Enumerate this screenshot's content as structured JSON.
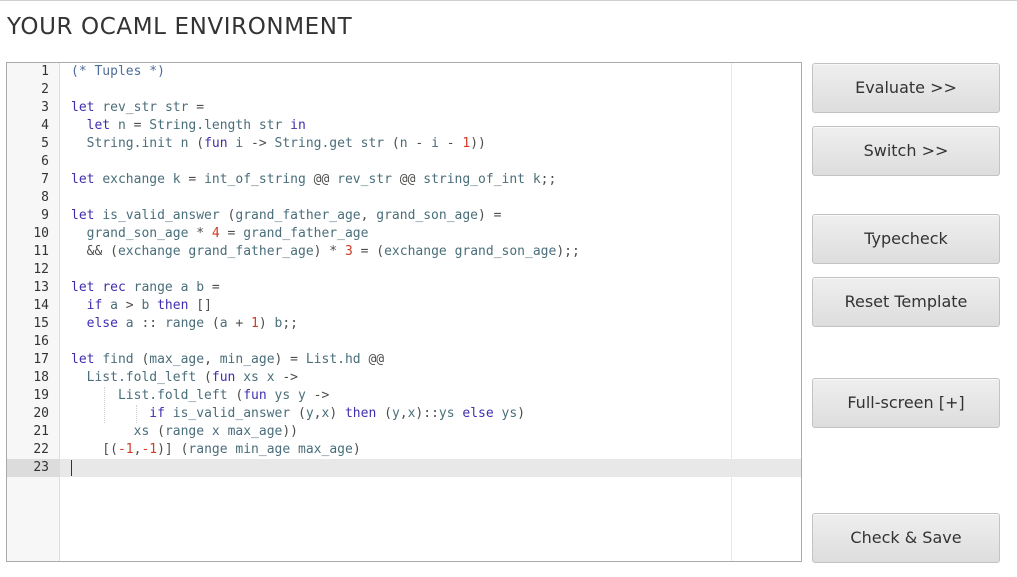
{
  "page": {
    "title": "YOUR OCAML ENVIRONMENT"
  },
  "editor": {
    "active_line": 23,
    "lines": [
      {
        "n": "1",
        "tokens": [
          {
            "c": "comment",
            "t": "(* Tuples *)"
          }
        ]
      },
      {
        "n": "2",
        "tokens": []
      },
      {
        "n": "3",
        "tokens": [
          {
            "c": "kw",
            "t": "let"
          },
          {
            "c": "op",
            "t": " "
          },
          {
            "c": "id",
            "t": "rev_str"
          },
          {
            "c": "op",
            "t": " "
          },
          {
            "c": "id",
            "t": "str"
          },
          {
            "c": "op",
            "t": " ="
          }
        ]
      },
      {
        "n": "4",
        "tokens": [
          {
            "c": "op",
            "t": "  "
          },
          {
            "c": "kw",
            "t": "let"
          },
          {
            "c": "op",
            "t": " "
          },
          {
            "c": "id",
            "t": "n"
          },
          {
            "c": "op",
            "t": " = "
          },
          {
            "c": "id",
            "t": "String.length"
          },
          {
            "c": "op",
            "t": " "
          },
          {
            "c": "id",
            "t": "str"
          },
          {
            "c": "op",
            "t": " "
          },
          {
            "c": "kw",
            "t": "in"
          }
        ]
      },
      {
        "n": "5",
        "tokens": [
          {
            "c": "op",
            "t": "  "
          },
          {
            "c": "id",
            "t": "String.init"
          },
          {
            "c": "op",
            "t": " "
          },
          {
            "c": "id",
            "t": "n"
          },
          {
            "c": "op",
            "t": " ("
          },
          {
            "c": "kw",
            "t": "fun"
          },
          {
            "c": "op",
            "t": " "
          },
          {
            "c": "id",
            "t": "i"
          },
          {
            "c": "op",
            "t": " -> "
          },
          {
            "c": "id",
            "t": "String.get"
          },
          {
            "c": "op",
            "t": " "
          },
          {
            "c": "id",
            "t": "str"
          },
          {
            "c": "op",
            "t": " ("
          },
          {
            "c": "id",
            "t": "n"
          },
          {
            "c": "op",
            "t": " - "
          },
          {
            "c": "id",
            "t": "i"
          },
          {
            "c": "op",
            "t": " - "
          },
          {
            "c": "num",
            "t": "1"
          },
          {
            "c": "op",
            "t": "))"
          }
        ]
      },
      {
        "n": "6",
        "tokens": []
      },
      {
        "n": "7",
        "tokens": [
          {
            "c": "kw",
            "t": "let"
          },
          {
            "c": "op",
            "t": " "
          },
          {
            "c": "id",
            "t": "exchange"
          },
          {
            "c": "op",
            "t": " "
          },
          {
            "c": "id",
            "t": "k"
          },
          {
            "c": "op",
            "t": " = "
          },
          {
            "c": "id",
            "t": "int_of_string"
          },
          {
            "c": "op",
            "t": " @@ "
          },
          {
            "c": "id",
            "t": "rev_str"
          },
          {
            "c": "op",
            "t": " @@ "
          },
          {
            "c": "id",
            "t": "string_of_int"
          },
          {
            "c": "op",
            "t": " "
          },
          {
            "c": "id",
            "t": "k"
          },
          {
            "c": "op",
            "t": ";;"
          }
        ]
      },
      {
        "n": "8",
        "tokens": []
      },
      {
        "n": "9",
        "tokens": [
          {
            "c": "kw",
            "t": "let"
          },
          {
            "c": "op",
            "t": " "
          },
          {
            "c": "id",
            "t": "is_valid_answer"
          },
          {
            "c": "op",
            "t": " ("
          },
          {
            "c": "id",
            "t": "grand_father_age"
          },
          {
            "c": "op",
            "t": ", "
          },
          {
            "c": "id",
            "t": "grand_son_age"
          },
          {
            "c": "op",
            "t": ") ="
          }
        ]
      },
      {
        "n": "10",
        "tokens": [
          {
            "c": "op",
            "t": "  "
          },
          {
            "c": "id",
            "t": "grand_son_age"
          },
          {
            "c": "op",
            "t": " * "
          },
          {
            "c": "num",
            "t": "4"
          },
          {
            "c": "op",
            "t": " = "
          },
          {
            "c": "id",
            "t": "grand_father_age"
          }
        ]
      },
      {
        "n": "11",
        "tokens": [
          {
            "c": "op",
            "t": "  && ("
          },
          {
            "c": "id",
            "t": "exchange"
          },
          {
            "c": "op",
            "t": " "
          },
          {
            "c": "id",
            "t": "grand_father_age"
          },
          {
            "c": "op",
            "t": ") * "
          },
          {
            "c": "num",
            "t": "3"
          },
          {
            "c": "op",
            "t": " = ("
          },
          {
            "c": "id",
            "t": "exchange"
          },
          {
            "c": "op",
            "t": " "
          },
          {
            "c": "id",
            "t": "grand_son_age"
          },
          {
            "c": "op",
            "t": ");;"
          }
        ]
      },
      {
        "n": "12",
        "tokens": []
      },
      {
        "n": "13",
        "tokens": [
          {
            "c": "kw",
            "t": "let"
          },
          {
            "c": "op",
            "t": " "
          },
          {
            "c": "kw",
            "t": "rec"
          },
          {
            "c": "op",
            "t": " "
          },
          {
            "c": "id",
            "t": "range"
          },
          {
            "c": "op",
            "t": " "
          },
          {
            "c": "id",
            "t": "a"
          },
          {
            "c": "op",
            "t": " "
          },
          {
            "c": "id",
            "t": "b"
          },
          {
            "c": "op",
            "t": " ="
          }
        ]
      },
      {
        "n": "14",
        "tokens": [
          {
            "c": "op",
            "t": "  "
          },
          {
            "c": "kw",
            "t": "if"
          },
          {
            "c": "op",
            "t": " "
          },
          {
            "c": "id",
            "t": "a"
          },
          {
            "c": "op",
            "t": " > "
          },
          {
            "c": "id",
            "t": "b"
          },
          {
            "c": "op",
            "t": " "
          },
          {
            "c": "kw",
            "t": "then"
          },
          {
            "c": "op",
            "t": " []"
          }
        ]
      },
      {
        "n": "15",
        "tokens": [
          {
            "c": "op",
            "t": "  "
          },
          {
            "c": "kw",
            "t": "else"
          },
          {
            "c": "op",
            "t": " "
          },
          {
            "c": "id",
            "t": "a"
          },
          {
            "c": "op",
            "t": " :: "
          },
          {
            "c": "id",
            "t": "range"
          },
          {
            "c": "op",
            "t": " ("
          },
          {
            "c": "id",
            "t": "a"
          },
          {
            "c": "op",
            "t": " + "
          },
          {
            "c": "num",
            "t": "1"
          },
          {
            "c": "op",
            "t": ") "
          },
          {
            "c": "id",
            "t": "b"
          },
          {
            "c": "op",
            "t": ";;"
          }
        ]
      },
      {
        "n": "16",
        "tokens": []
      },
      {
        "n": "17",
        "tokens": [
          {
            "c": "kw",
            "t": "let"
          },
          {
            "c": "op",
            "t": " "
          },
          {
            "c": "id",
            "t": "find"
          },
          {
            "c": "op",
            "t": " ("
          },
          {
            "c": "id",
            "t": "max_age"
          },
          {
            "c": "op",
            "t": ", "
          },
          {
            "c": "id",
            "t": "min_age"
          },
          {
            "c": "op",
            "t": ") = "
          },
          {
            "c": "id",
            "t": "List.hd"
          },
          {
            "c": "op",
            "t": " @@"
          }
        ]
      },
      {
        "n": "18",
        "tokens": [
          {
            "c": "op",
            "t": "  "
          },
          {
            "c": "id",
            "t": "List.fold_left"
          },
          {
            "c": "op",
            "t": " ("
          },
          {
            "c": "kw",
            "t": "fun"
          },
          {
            "c": "op",
            "t": " "
          },
          {
            "c": "id",
            "t": "xs"
          },
          {
            "c": "op",
            "t": " "
          },
          {
            "c": "id",
            "t": "x"
          },
          {
            "c": "op",
            "t": " ->"
          }
        ]
      },
      {
        "n": "19",
        "tokens": [
          {
            "c": "op",
            "t": "      "
          },
          {
            "c": "id",
            "t": "List.fold_left"
          },
          {
            "c": "op",
            "t": " ("
          },
          {
            "c": "kw",
            "t": "fun"
          },
          {
            "c": "op",
            "t": " "
          },
          {
            "c": "id",
            "t": "ys"
          },
          {
            "c": "op",
            "t": " "
          },
          {
            "c": "id",
            "t": "y"
          },
          {
            "c": "op",
            "t": " ->"
          }
        ]
      },
      {
        "n": "20",
        "tokens": [
          {
            "c": "op",
            "t": "          "
          },
          {
            "c": "kw",
            "t": "if"
          },
          {
            "c": "op",
            "t": " "
          },
          {
            "c": "id",
            "t": "is_valid_answer"
          },
          {
            "c": "op",
            "t": " ("
          },
          {
            "c": "id",
            "t": "y"
          },
          {
            "c": "op",
            "t": ","
          },
          {
            "c": "id",
            "t": "x"
          },
          {
            "c": "op",
            "t": ") "
          },
          {
            "c": "kw",
            "t": "then"
          },
          {
            "c": "op",
            "t": " ("
          },
          {
            "c": "id",
            "t": "y"
          },
          {
            "c": "op",
            "t": ","
          },
          {
            "c": "id",
            "t": "x"
          },
          {
            "c": "op",
            "t": ")::"
          },
          {
            "c": "id",
            "t": "ys"
          },
          {
            "c": "op",
            "t": " "
          },
          {
            "c": "kw",
            "t": "else"
          },
          {
            "c": "op",
            "t": " "
          },
          {
            "c": "id",
            "t": "ys"
          },
          {
            "c": "op",
            "t": ")"
          }
        ]
      },
      {
        "n": "21",
        "tokens": [
          {
            "c": "op",
            "t": "        "
          },
          {
            "c": "id",
            "t": "xs"
          },
          {
            "c": "op",
            "t": " ("
          },
          {
            "c": "id",
            "t": "range"
          },
          {
            "c": "op",
            "t": " "
          },
          {
            "c": "id",
            "t": "x"
          },
          {
            "c": "op",
            "t": " "
          },
          {
            "c": "id",
            "t": "max_age"
          },
          {
            "c": "op",
            "t": "))"
          }
        ]
      },
      {
        "n": "22",
        "tokens": [
          {
            "c": "op",
            "t": "    [("
          },
          {
            "c": "num",
            "t": "-1"
          },
          {
            "c": "op",
            "t": ","
          },
          {
            "c": "num",
            "t": "-1"
          },
          {
            "c": "op",
            "t": ")] ("
          },
          {
            "c": "id",
            "t": "range"
          },
          {
            "c": "op",
            "t": " "
          },
          {
            "c": "id",
            "t": "min_age"
          },
          {
            "c": "op",
            "t": " "
          },
          {
            "c": "id",
            "t": "max_age"
          },
          {
            "c": "op",
            "t": ")"
          }
        ]
      },
      {
        "n": "23",
        "tokens": []
      }
    ]
  },
  "buttons": {
    "evaluate": "Evaluate >>",
    "switch": "Switch >>",
    "typecheck": "Typecheck",
    "reset": "Reset Template",
    "fullscreen": "Full-screen [+]",
    "check_save": "Check & Save"
  },
  "colors": {
    "keyword": "#3f2fb0",
    "identifier": "#4a6e7a",
    "number": "#d03c27",
    "comment": "#4d6d9a"
  }
}
